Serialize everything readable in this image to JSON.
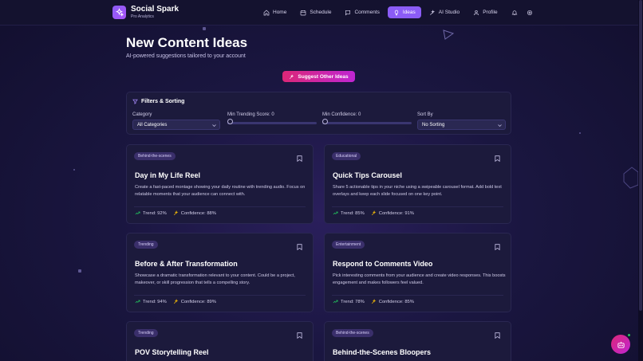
{
  "brand": {
    "name": "Social Spark",
    "subtitle": "Pro Analytics"
  },
  "nav": {
    "items": [
      {
        "label": "Home",
        "icon": "home-icon"
      },
      {
        "label": "Schedule",
        "icon": "calendar-icon"
      },
      {
        "label": "Comments",
        "icon": "comment-icon"
      },
      {
        "label": "Ideas",
        "icon": "lightbulb-icon",
        "active": true
      },
      {
        "label": "AI Studio",
        "icon": "sparkles-icon"
      },
      {
        "label": "Profile",
        "icon": "user-icon"
      }
    ]
  },
  "page": {
    "title": "New Content Ideas",
    "subtitle": "AI-powered suggestions tailored to your account"
  },
  "suggest_button": "Suggest Other Ideas",
  "filters": {
    "title": "Filters & Sorting",
    "category_label": "Category",
    "category_value": "All Categories",
    "trend_label": "Min Trending Score: 0",
    "trend_value": 0,
    "confidence_label": "Min Confidence: 0",
    "confidence_value": 0,
    "sort_label": "Sort By",
    "sort_value": "No Sorting"
  },
  "cards": [
    {
      "tag": "Behind-the-scenes",
      "title": "Day in My Life Reel",
      "description": "Create a fast-paced montage showing your daily routine with trending audio. Focus on relatable moments that your audience can connect with.",
      "trend": "Trend: 92%",
      "confidence": "Confidence: 88%"
    },
    {
      "tag": "Educational",
      "title": "Quick Tips Carousel",
      "description": "Share 5 actionable tips in your niche using a swipeable carousel format. Add bold text overlays and keep each slide focused on one key point.",
      "trend": "Trend: 85%",
      "confidence": "Confidence: 91%"
    },
    {
      "tag": "Trending",
      "title": "Before & After Transformation",
      "description": "Showcase a dramatic transformation relevant to your content. Could be a project, makeover, or skill progression that tells a compelling story.",
      "trend": "Trend: 94%",
      "confidence": "Confidence: 89%"
    },
    {
      "tag": "Entertainment",
      "title": "Respond to Comments Video",
      "description": "Pick interesting comments from your audience and create video responses. This boosts engagement and makes followers feel valued.",
      "trend": "Trend: 78%",
      "confidence": "Confidence: 85%"
    },
    {
      "tag": "Trending",
      "title": "POV Storytelling Reel",
      "description": "",
      "trend": "",
      "confidence": ""
    },
    {
      "tag": "Behind-the-scenes",
      "title": "Behind-the-Scenes Bloopers",
      "description": "",
      "trend": "",
      "confidence": ""
    }
  ],
  "colors": {
    "accent": "#8b5cf6",
    "cta": "#db2777",
    "trend_icon": "#22c55e",
    "confidence_icon": "#eab308"
  }
}
